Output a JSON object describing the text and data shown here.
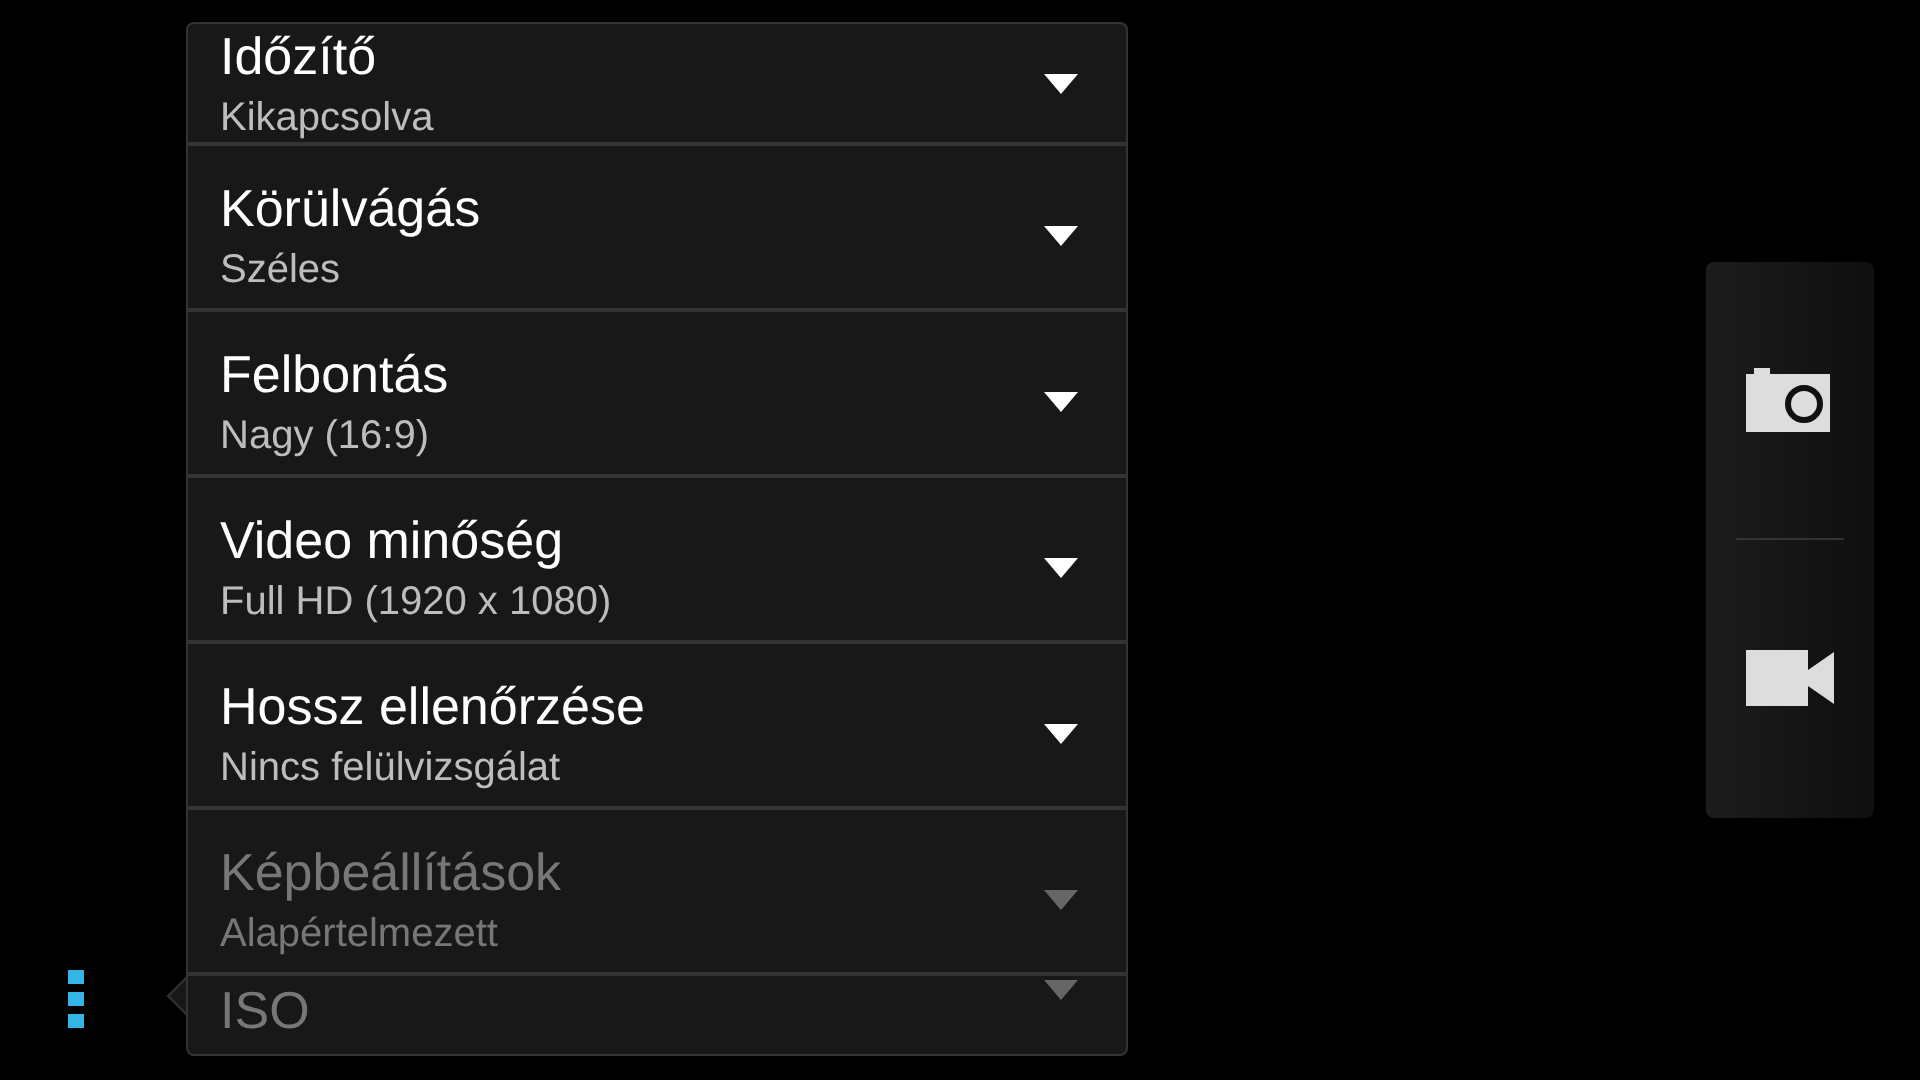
{
  "settings": [
    {
      "title": "Időzítő",
      "value": "Kikapcsolva",
      "disabled": false
    },
    {
      "title": "Körülvágás",
      "value": "Széles",
      "disabled": false
    },
    {
      "title": "Felbontás",
      "value": "Nagy (16:9)",
      "disabled": false
    },
    {
      "title": "Video minőség",
      "value": "Full HD (1920 x 1080)",
      "disabled": false
    },
    {
      "title": "Hossz ellenőrzése",
      "value": "Nincs felülvizsgálat",
      "disabled": false
    },
    {
      "title": "Képbeállítások",
      "value": "Alapértelmezett",
      "disabled": true
    },
    {
      "title": "ISO",
      "disabled": true
    }
  ],
  "mode_switcher": {
    "modes": [
      {
        "kind": "photo",
        "selected": false
      },
      {
        "kind": "video",
        "selected": false
      }
    ]
  }
}
